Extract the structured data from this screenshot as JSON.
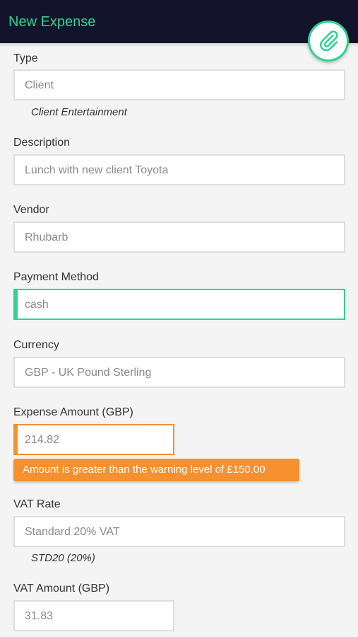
{
  "header": {
    "title": "New Expense",
    "attach_icon": "paperclip-icon"
  },
  "form": {
    "type": {
      "label": "Type",
      "value": "Client",
      "detail": "Client Entertainment"
    },
    "description": {
      "label": "Description",
      "value": "Lunch with new client Toyota"
    },
    "vendor": {
      "label": "Vendor",
      "value": "Rhubarb"
    },
    "payment_method": {
      "label": "Payment Method",
      "value": "cash"
    },
    "currency": {
      "label": "Currency",
      "value": "GBP - UK Pound Sterling"
    },
    "expense_amount": {
      "label": "Expense Amount (GBP)",
      "value": "214.82",
      "warning": "Amount is greater than the warning level of £150.00"
    },
    "vat_rate": {
      "label": "VAT Rate",
      "value": "Standard 20% VAT",
      "detail": "STD20 (20%)"
    },
    "vat_amount": {
      "label": "VAT Amount (GBP)",
      "value": "31.83"
    }
  },
  "colors": {
    "appbar": "#13132b",
    "accent": "#2ed48f",
    "warning": "#f7902f"
  }
}
